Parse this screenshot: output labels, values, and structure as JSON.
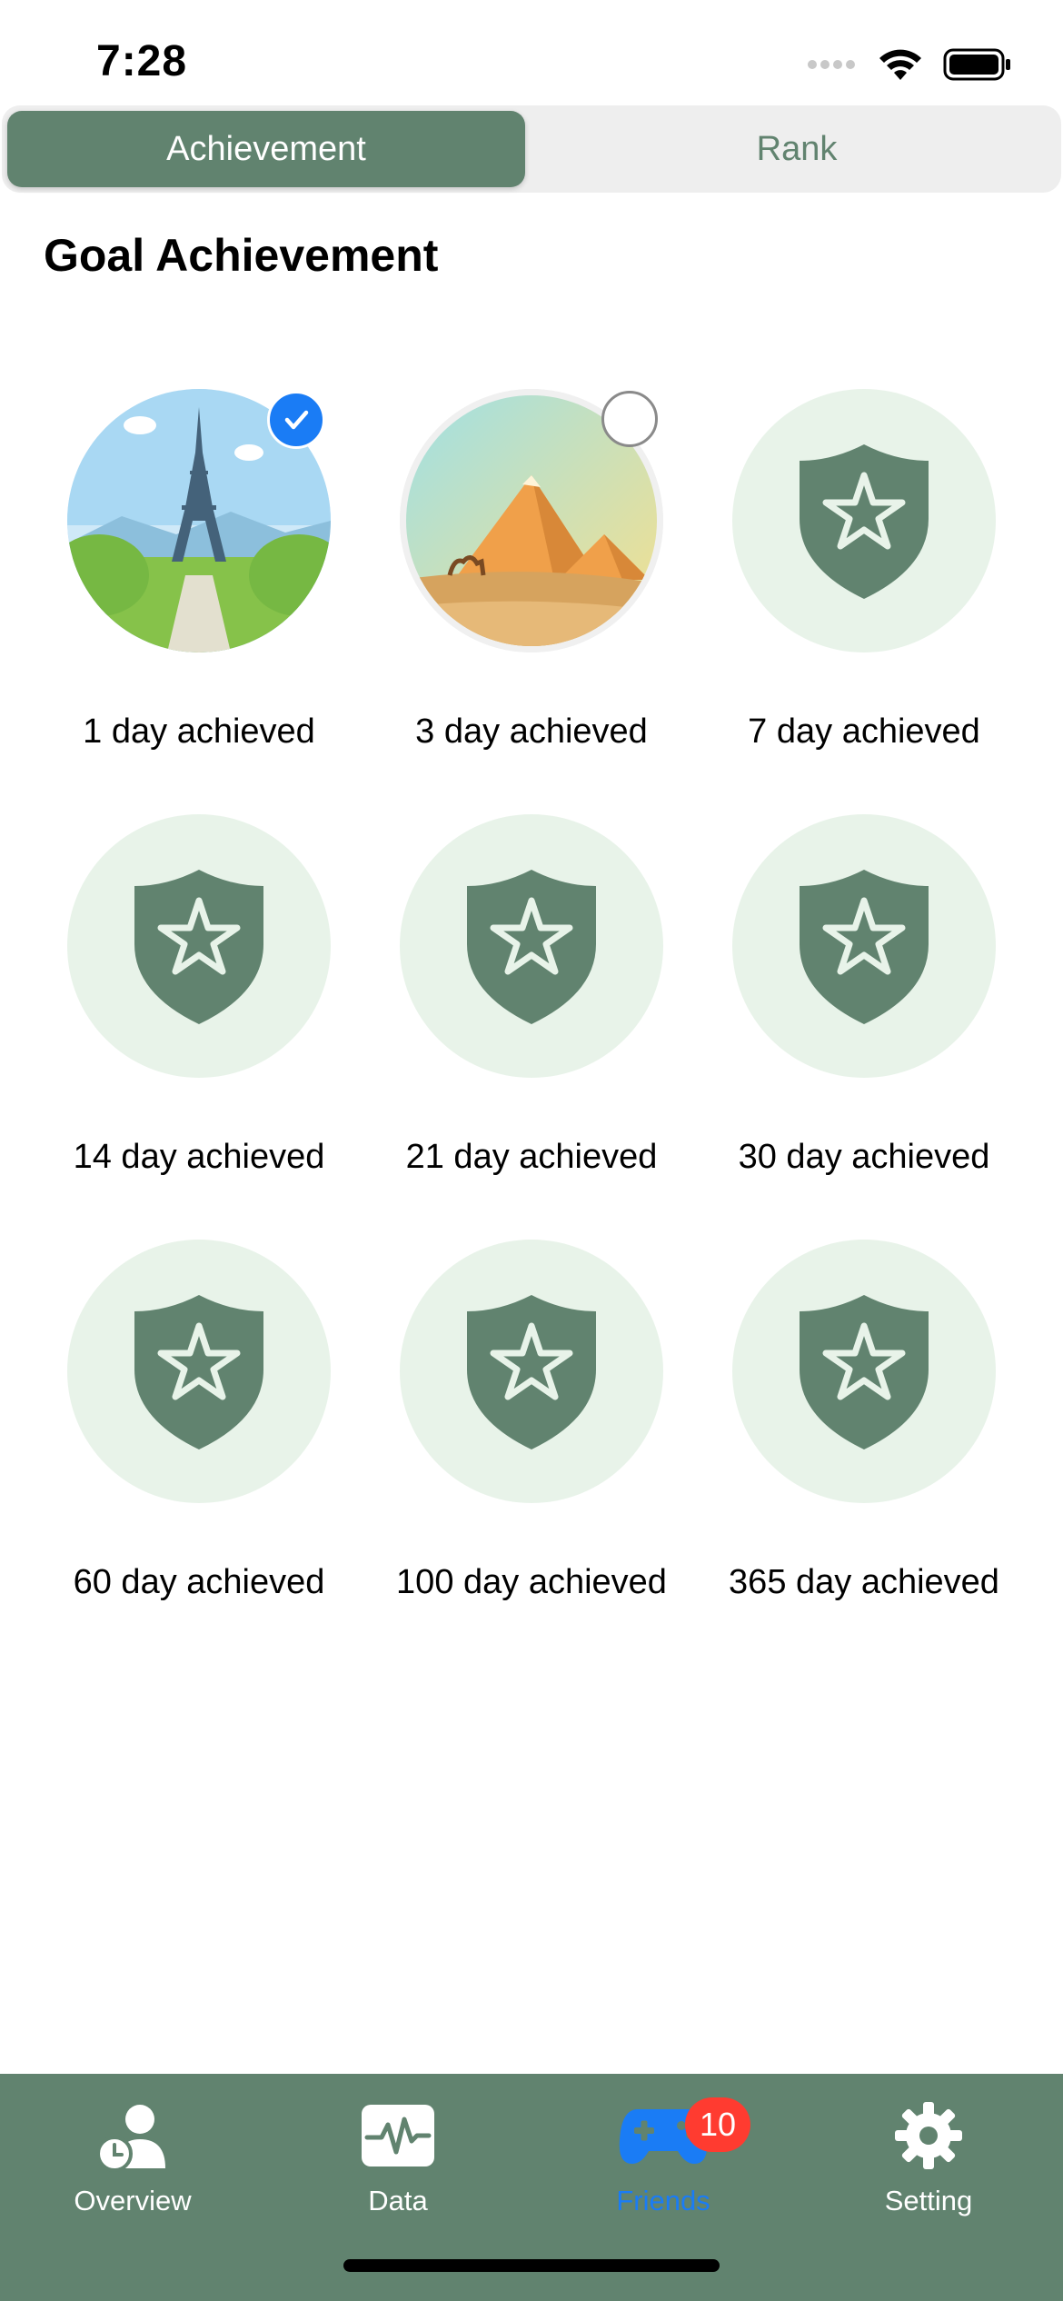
{
  "status_bar": {
    "time": "7:28"
  },
  "tabs_segment": {
    "achievement_label": "Achievement",
    "rank_label": "Rank",
    "active": "Achievement"
  },
  "title": "Goal Achievement",
  "achievements": [
    {
      "label": "1 day achieved",
      "image": "eiffel-tower",
      "state": "selected"
    },
    {
      "label": "3 day achieved",
      "image": "pyramids",
      "state": "unselected"
    },
    {
      "label": "7 day achieved",
      "image": "shield-star-icon",
      "state": "locked"
    },
    {
      "label": "14 day achieved",
      "image": "shield-star-icon",
      "state": "locked"
    },
    {
      "label": "21 day achieved",
      "image": "shield-star-icon",
      "state": "locked"
    },
    {
      "label": "30 day achieved",
      "image": "shield-star-icon",
      "state": "locked"
    },
    {
      "label": "60 day achieved",
      "image": "shield-star-icon",
      "state": "locked"
    },
    {
      "label": "100 day achieved",
      "image": "shield-star-icon",
      "state": "locked"
    },
    {
      "label": "365 day achieved",
      "image": "shield-star-icon",
      "state": "locked"
    }
  ],
  "tabbar": {
    "items": [
      {
        "label": "Overview",
        "icon": "person-clock-icon"
      },
      {
        "label": "Data",
        "icon": "activity-chart-icon"
      },
      {
        "label": "Friends",
        "icon": "gamepad-icon",
        "badge": "10",
        "selected": true
      },
      {
        "label": "Setting",
        "icon": "gear-icon"
      }
    ]
  },
  "colors": {
    "primary_green": "#61836f",
    "badge_bg": "#e8f3e9",
    "selected_blue": "#1a7cf5",
    "badge_red": "#ff3b30"
  }
}
